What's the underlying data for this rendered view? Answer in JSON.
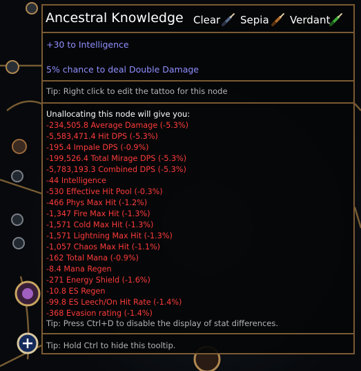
{
  "tooltip": {
    "title": "Ancestral Knowledge",
    "dyes": [
      {
        "label": "Clear",
        "icon": "paintbrush-icon",
        "color": "#5a6a8c"
      },
      {
        "label": "Sepia",
        "icon": "paintbrush-icon",
        "color": "#b06a2a"
      },
      {
        "label": "Verdant",
        "icon": "paintbrush-icon",
        "color": "#3fae3a"
      }
    ],
    "mods": [
      "+30 to Intelligence",
      "5% chance to deal Double Damage"
    ],
    "tip_tattoo": "Tip: Right click to edit the tattoo for this node",
    "diff_header": "Unallocating this node will give you:",
    "diffs": [
      "-234,505.8 Average Damage (-5.3%)",
      "-5,583,471.4 Hit DPS (-5.3%)",
      "-195.4 Impale DPS (-0.9%)",
      "-199,526.4 Total Mirage DPS (-5.3%)",
      "-5,783,193.3 Combined DPS (-5.3%)",
      "-44 Intelligence",
      "-530 Effective Hit Pool (-0.3%)",
      "-466 Phys Max Hit (-1.2%)",
      "-1,347 Fire Max Hit (-1.3%)",
      "-1,571 Cold Max Hit (-1.3%)",
      "-1,571 Lightning Max Hit (-1.3%)",
      "-1,057 Chaos Max Hit (-1.1%)",
      "-162 Total Mana (-0.9%)",
      "-8.4 Mana Regen",
      "-271 Energy Shield (-1.6%)",
      "-10.8 ES Regen",
      "-99.8 ES Leech/On Hit Rate (-1.4%)",
      "-368 Evasion rating (-1.4%)"
    ],
    "tip_ctrl_d": "Tip: Press Ctrl+D to disable the display of stat differences.",
    "tip_ctrl": "Tip: Hold Ctrl to hide this tooltip."
  },
  "colors": {
    "border": "#7b5a33",
    "mod_text": "#8f8fff",
    "diff_negative": "#ff3b3b",
    "tip_text": "#b4b4b4"
  }
}
